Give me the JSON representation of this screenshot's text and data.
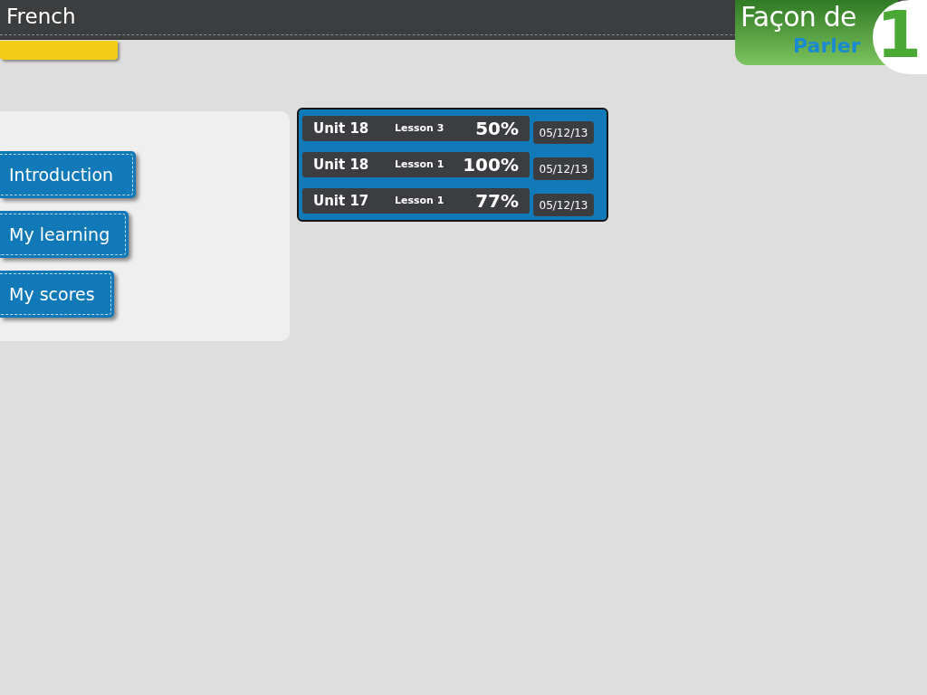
{
  "header": {
    "title": "French"
  },
  "logo": {
    "line_1": "Façon de",
    "line_2": "Parler",
    "number": "1"
  },
  "menu": [
    {
      "label": "Introduction"
    },
    {
      "label": "My learning"
    },
    {
      "label": "My scores"
    }
  ],
  "scores": [
    {
      "unit": "Unit 18",
      "lesson": "Lesson 3",
      "percent": "50%",
      "date": "05/12/13"
    },
    {
      "unit": "Unit 18",
      "lesson": "Lesson 1",
      "percent": "100%",
      "date": "05/12/13"
    },
    {
      "unit": "Unit 17",
      "lesson": "Lesson 1",
      "percent": "77%",
      "date": "05/12/13"
    }
  ]
}
